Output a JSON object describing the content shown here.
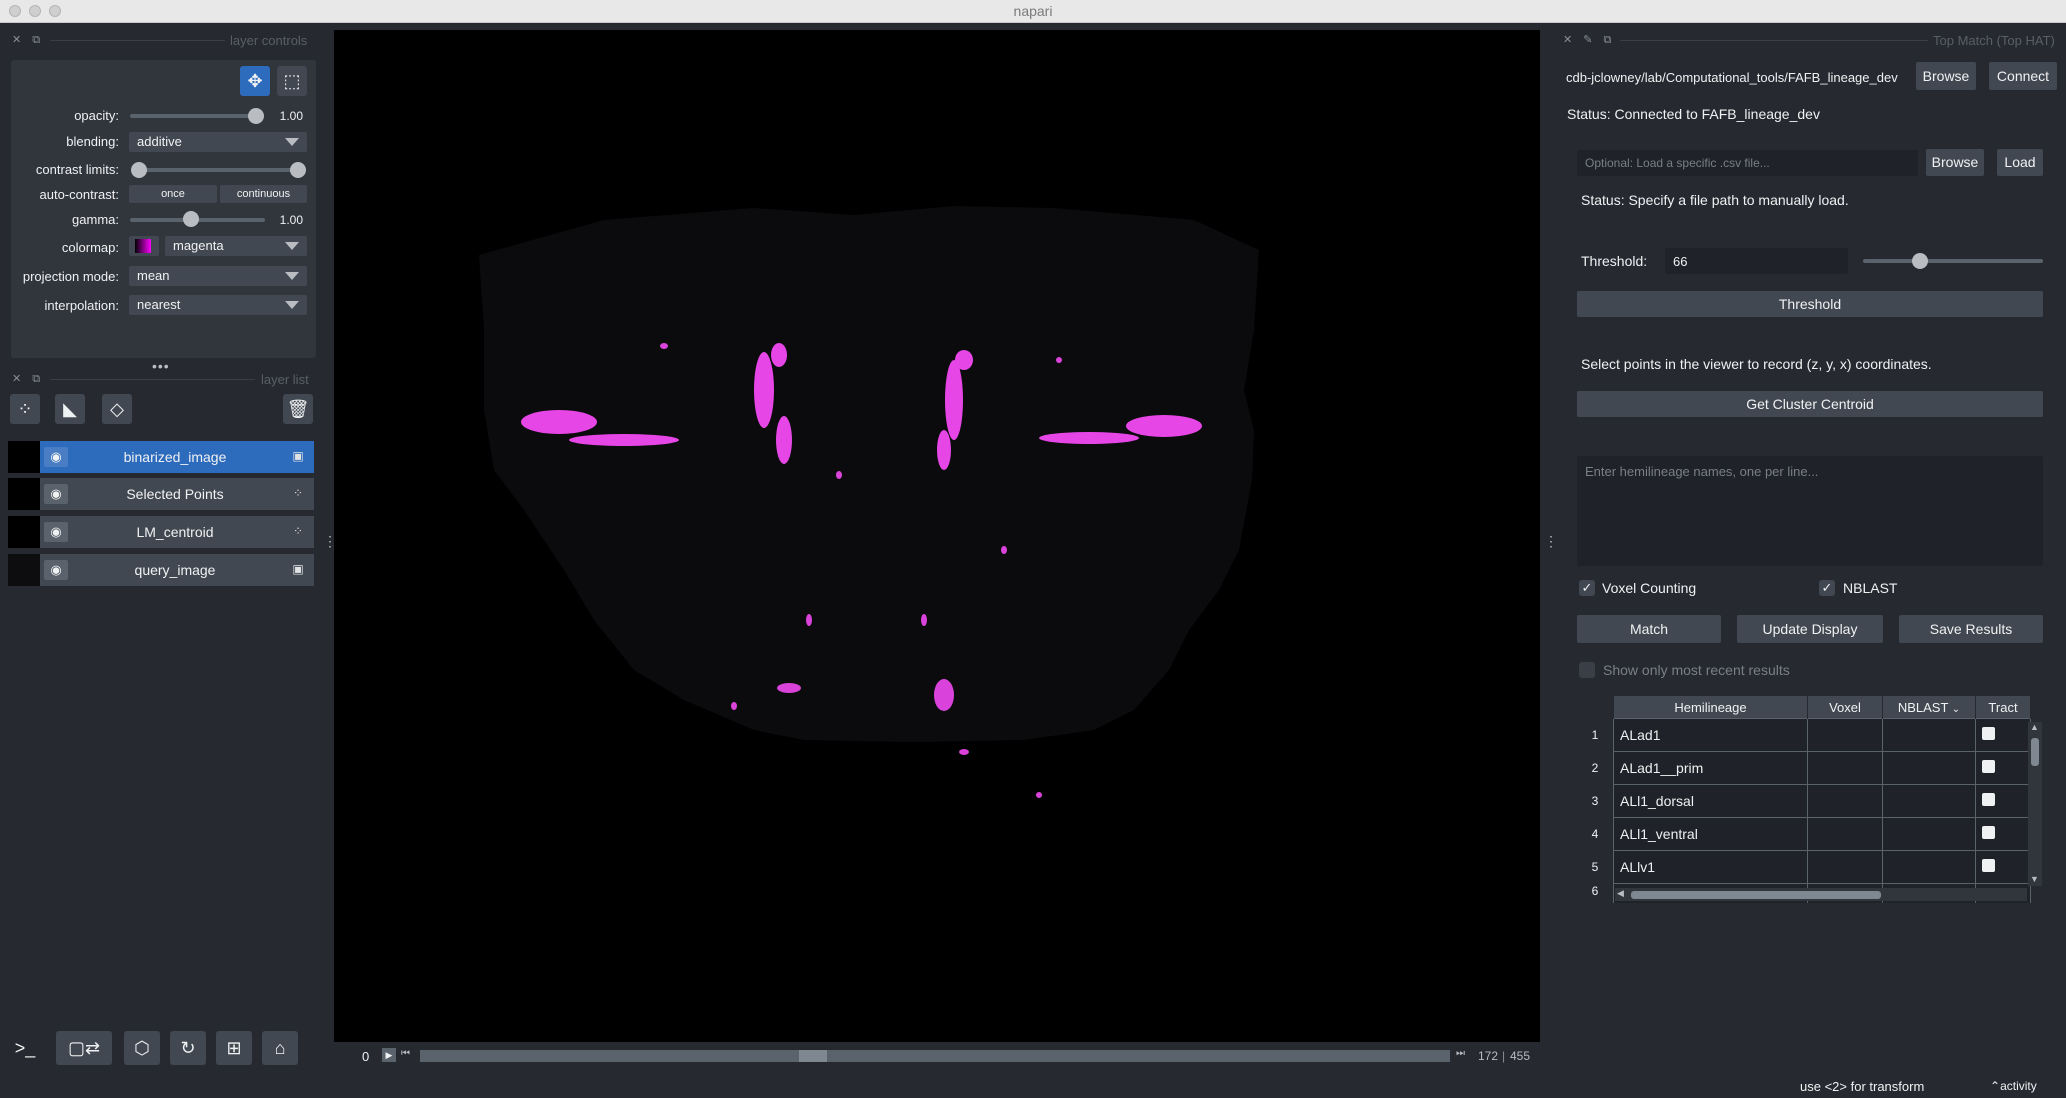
{
  "window": {
    "title": "napari"
  },
  "layer_controls": {
    "dock_title": "layer controls",
    "labels": {
      "opacity": "opacity:",
      "blending": "blending:",
      "contrast": "contrast limits:",
      "auto_contrast": "auto-contrast:",
      "gamma": "gamma:",
      "colormap": "colormap:",
      "projection": "projection mode:",
      "interpolation": "interpolation:"
    },
    "opacity_value": "1.00",
    "opacity": 1.0,
    "blending": "additive",
    "contrast_limits": [
      0.0,
      1.0
    ],
    "auto_contrast_once": "once",
    "auto_contrast_continuous": "continuous",
    "gamma_value": "1.00",
    "gamma": 0.47,
    "colormap": "magenta",
    "projection_mode": "mean",
    "interpolation": "nearest",
    "icons": [
      "pan-zoom-icon",
      "transform-icon"
    ]
  },
  "layer_list": {
    "dock_title": "layer list",
    "layers": [
      {
        "name": "binarized_image",
        "type": "image",
        "selected": true
      },
      {
        "name": "Selected Points",
        "type": "points",
        "selected": false
      },
      {
        "name": "LM_centroid",
        "type": "points",
        "selected": false
      },
      {
        "name": "query_image",
        "type": "image",
        "selected": false
      }
    ]
  },
  "viewer": {
    "slider_value": "0",
    "current_step": "172",
    "total_steps": "455",
    "slider_position": 0.378
  },
  "right_panel": {
    "dock_title": "Top Match (Top HAT)",
    "db_path": "cdb-jclowney/lab/Computational_tools/FAFB_lineage_dev",
    "browse_label": "Browse",
    "connect_label": "Connect",
    "status_connected": "Status: Connected to FAFB_lineage_dev",
    "csv_placeholder": "Optional: Load a specific .csv file...",
    "browse2_label": "Browse",
    "load_label": "Load",
    "status_file": "Status: Specify a file path to manually load.",
    "threshold_label": "Threshold:",
    "threshold_value": "66",
    "threshold_slider": 0.3,
    "threshold_button": "Threshold",
    "select_points_text": "Select points in the viewer to record (z, y, x) coordinates.",
    "centroid_button": "Get Cluster Centroid",
    "hemilineage_placeholder": "Enter hemilineage names, one per line...",
    "voxel_counting_label": "Voxel Counting",
    "voxel_counting_checked": true,
    "nblast_label": "NBLAST",
    "nblast_checked": true,
    "match_label": "Match",
    "update_display_label": "Update Display",
    "save_results_label": "Save Results",
    "show_recent_label": "Show only most recent results",
    "table": {
      "headers": [
        "Hemilineage",
        "Voxel",
        "NBLAST",
        "Tract"
      ],
      "rows": [
        {
          "num": "1",
          "name": "ALad1"
        },
        {
          "num": "2",
          "name": "ALad1__prim"
        },
        {
          "num": "3",
          "name": "ALl1_dorsal"
        },
        {
          "num": "4",
          "name": "ALl1_ventral"
        },
        {
          "num": "5",
          "name": "ALlv1"
        }
      ],
      "partial_row_num": "6"
    }
  },
  "status_bar": {
    "hint": "use <2> for transform",
    "activity": "activity"
  },
  "colors": {
    "background": "#262930",
    "panel": "#414851",
    "selected": "#2d6bbd",
    "signal": "#ff4dff"
  }
}
